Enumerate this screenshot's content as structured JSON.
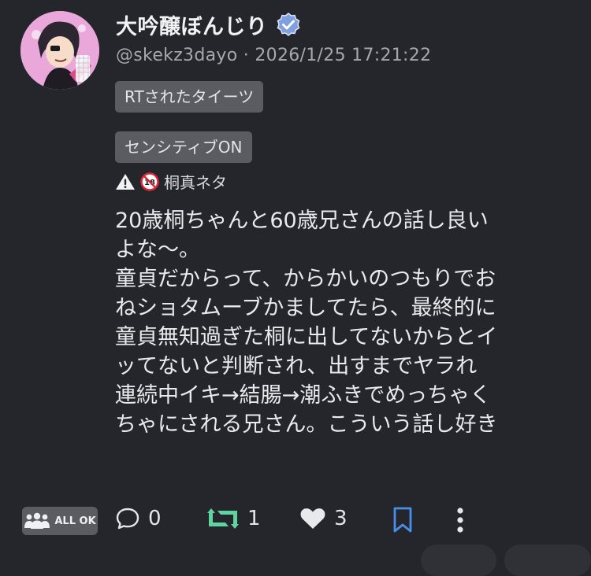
{
  "post": {
    "author_name": "大吟醸ぼんじり",
    "verified_icon": "verified-check-icon",
    "handle": "@skekz3dayo",
    "separator": "·",
    "timestamp": "2026/1/25 17:21:22",
    "rt_tag": "RTされたタイーツ",
    "sensitive_tag": "センシティブON",
    "content_warning": {
      "warning_icon": "warning-icon",
      "r18_icon": "no-under-18-icon",
      "label": "桐真ネタ"
    },
    "body_lines": [
      "20歳桐ちゃんと60歳兄さんの話し良い",
      "よな〜。",
      "童貞だからって、からかいのつもりでお",
      "ねショタムーブかましてたら、最終的に",
      "童貞無知過ぎた桐に出してないからとイ",
      "ッてないと判断され、出すまでヤラれ",
      "連続中イキ→結腸→潮ふきでめっちゃく",
      "ちゃにされる兄さん。こういう話し好き"
    ]
  },
  "actions": {
    "audience_label": "ALL OK",
    "reply_count": "0",
    "repost_count": "1",
    "like_count": "3"
  },
  "colors": {
    "background": "#24262b",
    "tag_bg": "#5a5c61",
    "verified": "#7f9fe0",
    "repost": "#5fd4a0",
    "bookmark": "#4a8fe7"
  }
}
